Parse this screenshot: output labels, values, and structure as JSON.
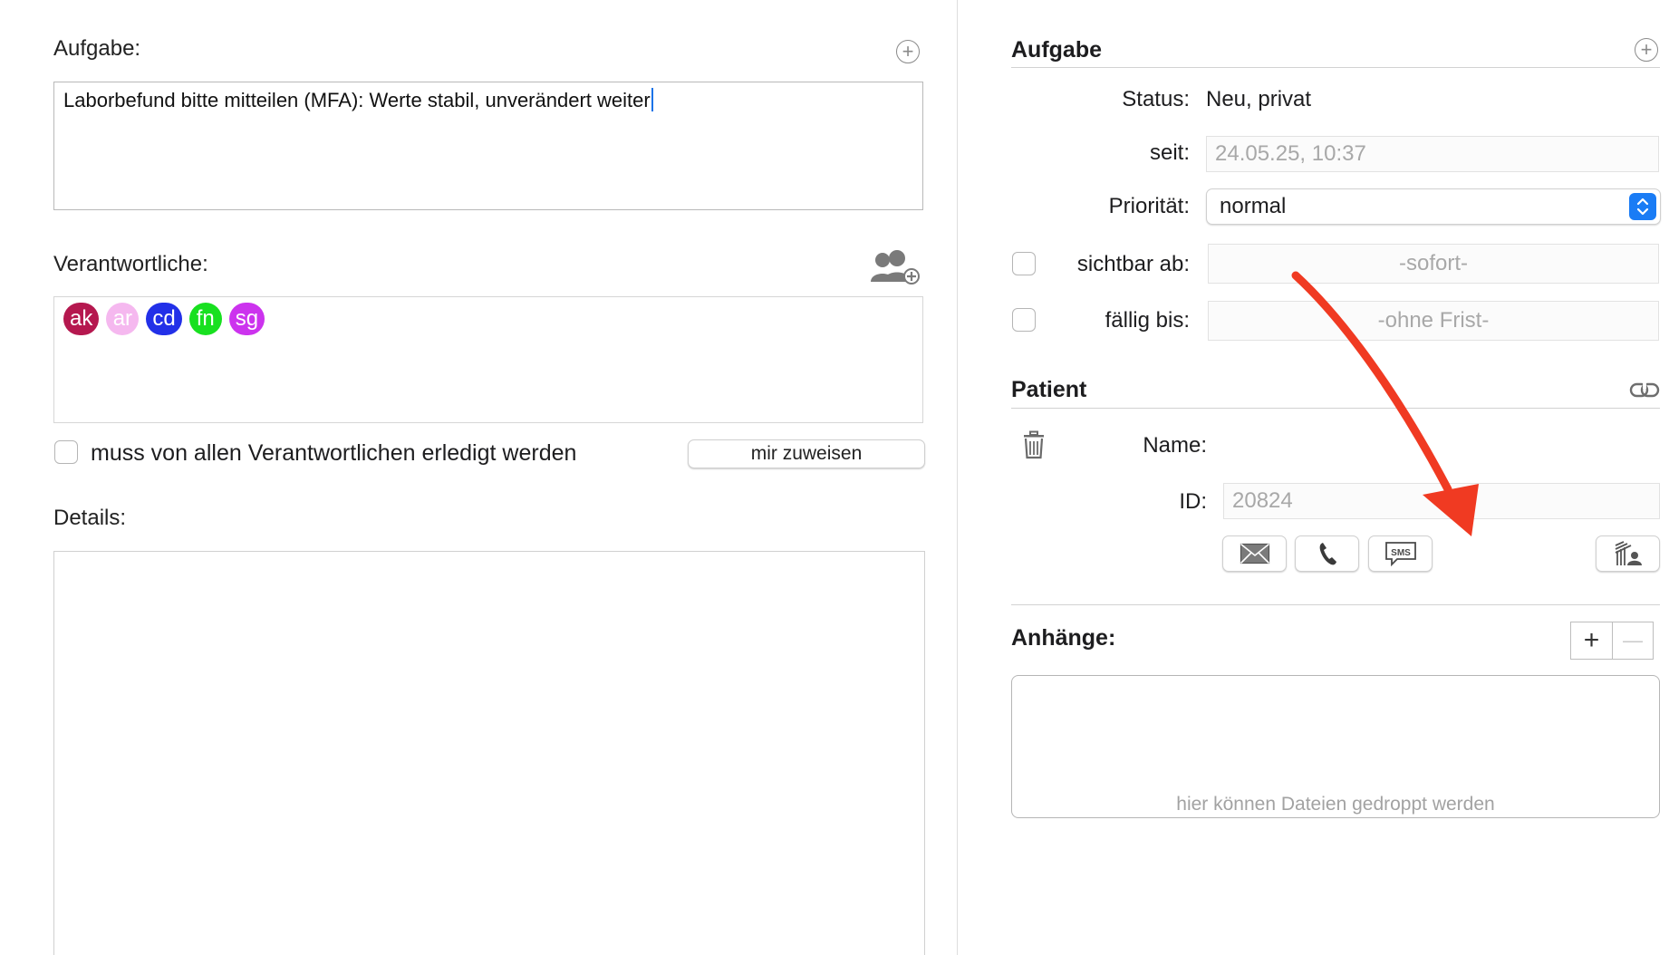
{
  "left": {
    "task_label": "Aufgabe:",
    "task_text": "Laborbefund bitte mitteilen (MFA): Werte stabil, unverändert weiter",
    "responsible_label": "Verantwortliche:",
    "chips": [
      {
        "text": "ak",
        "color": "#b5184f"
      },
      {
        "text": "ar",
        "color": "#f5b8ef"
      },
      {
        "text": "cd",
        "color": "#2230e8"
      },
      {
        "text": "fn",
        "color": "#18e020"
      },
      {
        "text": "sg",
        "color": "#cc33ee"
      }
    ],
    "all_done_label": "muss von allen Verantwortlichen erledigt werden",
    "assign_me_label": "mir zuweisen",
    "details_label": "Details:"
  },
  "right": {
    "task_section_title": "Aufgabe",
    "status_label": "Status:",
    "status_value": "Neu, privat",
    "since_label": "seit:",
    "since_value": "24.05.25, 10:37",
    "priority_label": "Priorität:",
    "priority_value": "normal",
    "visible_label": "sichtbar ab:",
    "visible_value": "-sofort-",
    "due_label": "fällig bis:",
    "due_value": "-ohne Frist-",
    "patient_section_title": "Patient",
    "name_label": "Name:",
    "id_label": "ID:",
    "id_value": "20824",
    "sms_label": "SMS",
    "attachments_title": "Anhänge:",
    "drop_hint": "hier können Dateien gedroppt werden",
    "add_label": "+",
    "remove_label": "—"
  },
  "colors": {
    "accent": "#1a7cf5",
    "arrow": "#f03a22"
  }
}
